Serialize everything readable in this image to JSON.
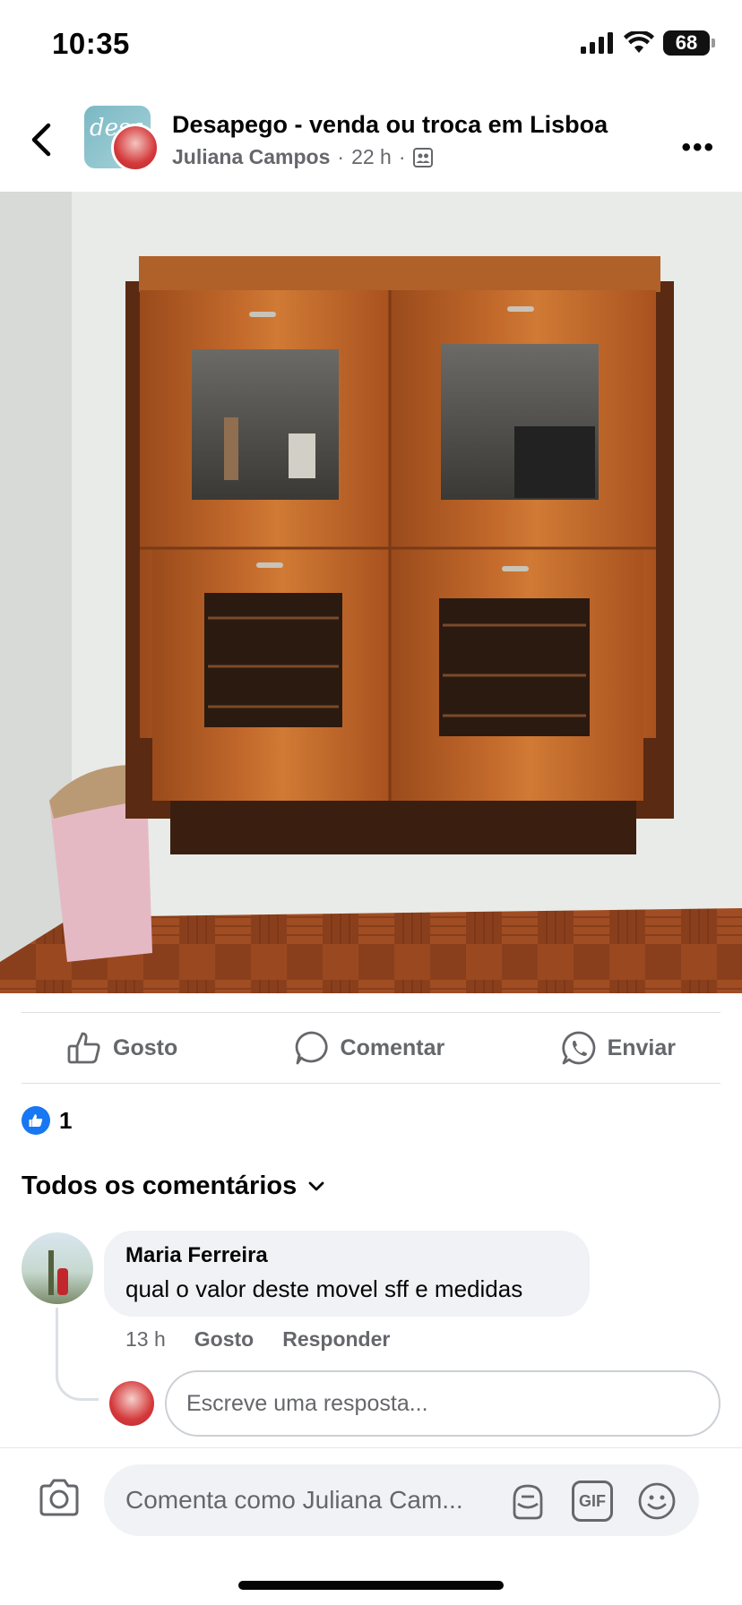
{
  "status_bar": {
    "time": "10:35",
    "battery": "68"
  },
  "header": {
    "group_name": "Desapego - venda ou troca em Lisboa",
    "group_avatar_text": "desa",
    "author": "Juliana Campos",
    "time_ago": "22 h",
    "separator": "·"
  },
  "actions": {
    "like": "Gosto",
    "comment": "Comentar",
    "send": "Enviar"
  },
  "reactions": {
    "count": "1"
  },
  "comments": {
    "heading": "Todos os comentários",
    "items": [
      {
        "author": "Maria Ferreira",
        "text": "qual o valor deste movel sff e medidas",
        "time": "13 h",
        "like": "Gosto",
        "reply": "Responder"
      }
    ],
    "reply_placeholder": "Escreve uma resposta..."
  },
  "composer": {
    "placeholder": "Comenta como Juliana Cam...",
    "gif_label": "GIF"
  },
  "colors": {
    "brand_blue": "#1877f2",
    "secondary_text": "#65676b",
    "bubble_bg": "#f0f2f5"
  }
}
